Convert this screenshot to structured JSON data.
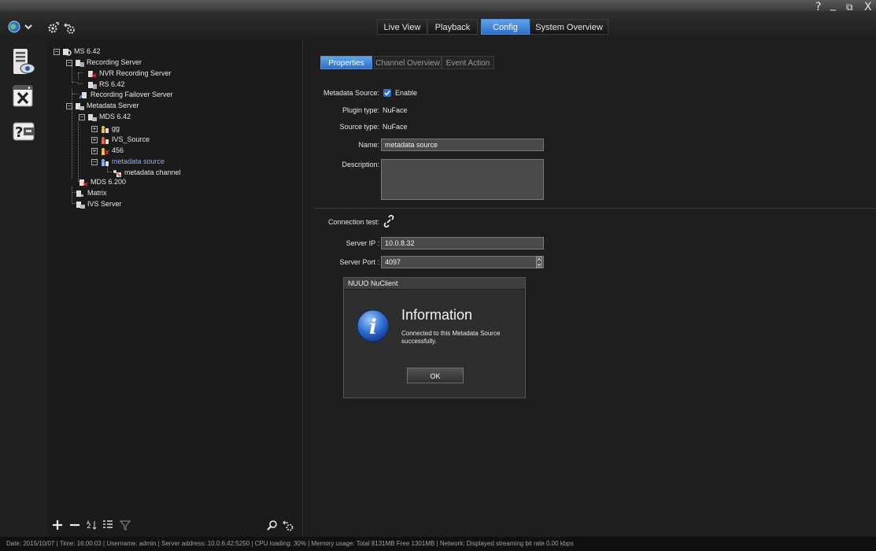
{
  "window_controls": {
    "help": "?",
    "minimize": "_",
    "restore": "⧉",
    "close": "X"
  },
  "tabs": [
    "Live View",
    "Playback",
    "Config",
    "System Overview"
  ],
  "active_tab": "Config",
  "tree": {
    "root": "MS 6.42",
    "recording_server": "Recording Server",
    "nvr_recording_server": "NVR Recording Server",
    "rs": "RS 6.42",
    "failover": "Recording Failover Server",
    "metadata_server": "Metadata Server",
    "mds_642": "MDS 6.42",
    "gg": "gg",
    "ivs_source": "IVS_Source",
    "n456": "456",
    "metadata_source": "metadata source",
    "metadata_channel": "metadata channel",
    "mds_6200": "MDS 6.200",
    "matrix": "Matrix",
    "ivs_server": "IVS Server"
  },
  "subtabs": [
    "Properties",
    "Channel Overview",
    "Event Action"
  ],
  "form": {
    "metadata_source_label": "Metadata Source:",
    "enable_label": "Enable",
    "enable_checked": true,
    "plugin_type_label": "Plugin type:",
    "plugin_type_value": "NuFace",
    "source_type_label": "Source type:",
    "source_type_value": "NuFace",
    "name_label": "Name:",
    "name_value": "metadata source",
    "description_label": "Description:",
    "description_value": "",
    "connection_test_label": "Connection test:",
    "server_ip_label": "Server IP :",
    "server_ip_value": "10.0.8.32",
    "server_port_label": "Server Port :",
    "server_port_value": "4097"
  },
  "dialog": {
    "title": "NUUO NuClient",
    "heading": "Information",
    "message": "Connected to this Metadata Source successfully.",
    "ok": "OK"
  },
  "status_bar": "Date: 2015/10/07  |  Time: 16:00:03  |  Username: admin  |  Server address: 10.0.6.42:5250  |  CPU loading: 30%  |  Memory usage: Total 8131MB  Free 1301MB  |  Network: Displayed streaming bit rate    0.00 kbps",
  "colors": {
    "accent": "#3a80dc",
    "background": "#1c1c1c",
    "selected_text": "#7fb4ff"
  }
}
